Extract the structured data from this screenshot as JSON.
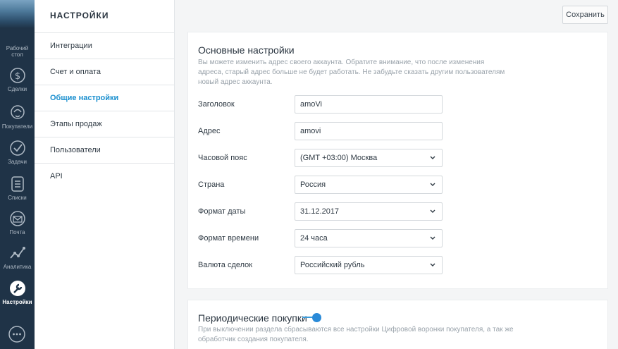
{
  "nav": {
    "items": [
      {
        "id": "desktop",
        "label": "Рабочий стол",
        "icon": "desktop-icon"
      },
      {
        "id": "deals",
        "label": "Сделки",
        "icon": "dollar-icon"
      },
      {
        "id": "buyers",
        "label": "Покупатели",
        "icon": "buyers-icon"
      },
      {
        "id": "tasks",
        "label": "Задачи",
        "icon": "check-icon"
      },
      {
        "id": "lists",
        "label": "Списки",
        "icon": "list-icon"
      },
      {
        "id": "mail",
        "label": "Почта",
        "icon": "mail-icon"
      },
      {
        "id": "analytics",
        "label": "Аналитика",
        "icon": "analytics-icon"
      },
      {
        "id": "settings",
        "label": "Настройки",
        "icon": "wrench-icon",
        "active": true
      }
    ],
    "chat_icon": "chat-icon"
  },
  "settings_panel": {
    "title": "НАСТРОЙКИ",
    "items": [
      {
        "label": "Интеграции"
      },
      {
        "label": "Счет и оплата"
      },
      {
        "label": "Общие настройки",
        "active": true
      },
      {
        "label": "Этапы продаж"
      },
      {
        "label": "Пользователи"
      },
      {
        "label": "API"
      }
    ]
  },
  "toolbar": {
    "save_label": "Сохранить"
  },
  "main_settings": {
    "title": "Основные настройки",
    "description": "Вы можете изменить адрес своего аккаунта. Обратите внимание, что после изменения адреса, старый адрес больше не будет работать. Не забудьте сказать другим пользователям новый адрес аккаунта.",
    "fields": {
      "title": {
        "label": "Заголовок",
        "value": "amoVi"
      },
      "address": {
        "label": "Адрес",
        "value": "amovi"
      },
      "timezone": {
        "label": "Часовой пояс",
        "value": "(GMT +03:00) Москва"
      },
      "country": {
        "label": "Страна",
        "value": "Россия"
      },
      "date_format": {
        "label": "Формат даты",
        "value": "31.12.2017"
      },
      "time_format": {
        "label": "Формат времени",
        "value": "24 часа"
      },
      "currency": {
        "label": "Валюта сделок",
        "value": "Российский рубль"
      }
    }
  },
  "periodic_purchases": {
    "title": "Периодические покупки",
    "enabled": true,
    "description": "При выключении раздела сбрасываются все настройки Цифровой воронки покупателя, а так же обработчик создания покупателя."
  },
  "colors": {
    "accent": "#1a8fcf",
    "rail": "#1f3347",
    "toggle": "#2a8ad8"
  }
}
